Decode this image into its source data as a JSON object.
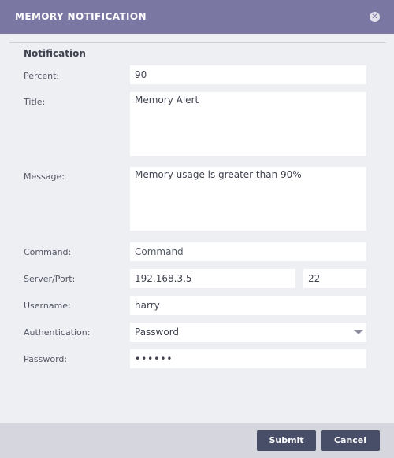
{
  "dialog": {
    "title": "MEMORY NOTIFICATION",
    "close_icon": "close-icon",
    "colors": {
      "titlebar": "#7b77a3",
      "button": "#484d68",
      "footer": "#d6d7de"
    }
  },
  "section": {
    "title": "Notification"
  },
  "form": {
    "percent": {
      "label": "Percent:",
      "value": "90"
    },
    "title": {
      "label": "Title:",
      "value": "Memory Alert"
    },
    "message": {
      "label": "Message:",
      "value": "Memory usage is greater than 90%"
    },
    "command": {
      "label": "Command:",
      "placeholder": "Command"
    },
    "server_port": {
      "label": "Server/Port:",
      "server": "192.168.3.5",
      "port": "22"
    },
    "username": {
      "label": "Username:",
      "value": "harry"
    },
    "authentication": {
      "label": "Authentication:",
      "value": "Password",
      "icon": "chevron-down-icon"
    },
    "password": {
      "label": "Password:",
      "value": "••••••"
    }
  },
  "footer": {
    "submit_label": "Submit",
    "cancel_label": "Cancel"
  }
}
